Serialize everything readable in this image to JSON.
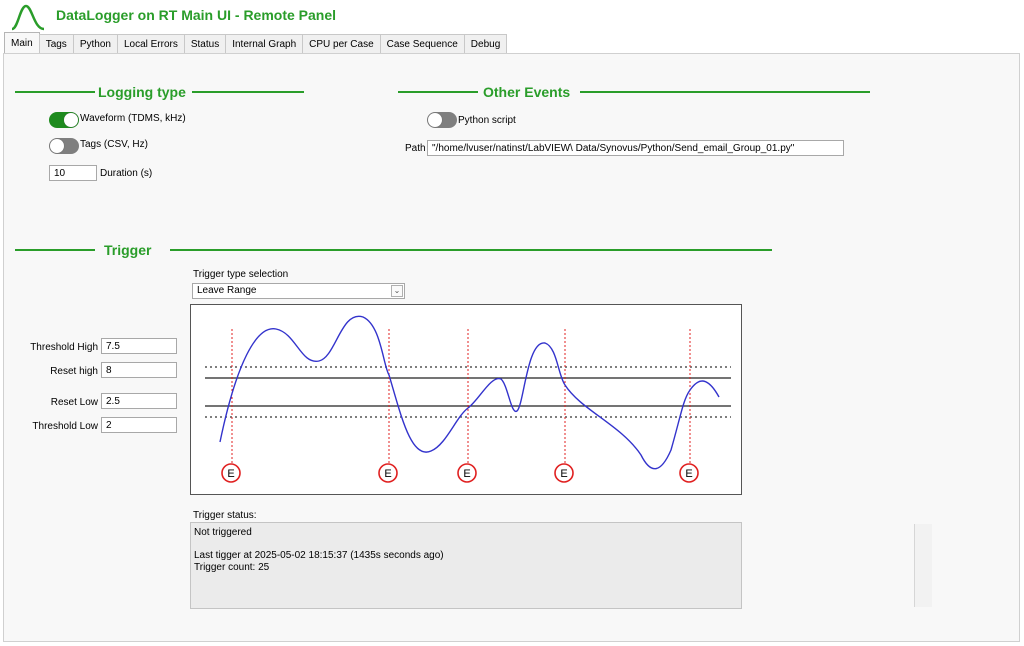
{
  "header": {
    "title": "DataLogger on RT Main UI - Remote Panel",
    "logo_icon": "waveform-logo-icon"
  },
  "tabs": [
    {
      "label": "Main",
      "active": true
    },
    {
      "label": "Tags"
    },
    {
      "label": "Python"
    },
    {
      "label": "Local Errors"
    },
    {
      "label": "Status"
    },
    {
      "label": "Internal Graph"
    },
    {
      "label": "CPU per Case"
    },
    {
      "label": "Case Sequence"
    },
    {
      "label": "Debug"
    }
  ],
  "logging_type": {
    "title": "Logging type",
    "waveform": {
      "label": "Waveform (TDMS, kHz)",
      "on": true
    },
    "tags": {
      "label": "Tags (CSV, Hz)",
      "on": false
    },
    "duration": {
      "value": "10",
      "label": "Duration (s)"
    }
  },
  "other_events": {
    "title": "Other Events",
    "python_script": {
      "label": "Python script",
      "on": false
    },
    "path": {
      "label": "Path",
      "value": "\"/home/lvuser/natinst/LabVIEW\\ Data/Synovus/Python/Send_email_Group_01.py\""
    }
  },
  "trigger": {
    "title": "Trigger",
    "type_label": "Trigger type selection",
    "type_value": "Leave Range",
    "threshold_high": {
      "label": "Threshold High",
      "value": "7.5"
    },
    "reset_high": {
      "label": "Reset high",
      "value": "8"
    },
    "reset_low": {
      "label": "Reset Low",
      "value": "2.5"
    },
    "threshold_low": {
      "label": "Threshold Low",
      "value": "2"
    },
    "status_label": "Trigger status:",
    "status_lines": [
      "Not triggered",
      "",
      "Last tigger at 2025-05-02 18:15:37 (1435s seconds ago)",
      "Trigger count: 25"
    ],
    "diagram": {
      "event_marker": "E",
      "colors": {
        "signal": "#3333cc",
        "event_line": "#e02020",
        "levels": "#222222"
      }
    }
  }
}
